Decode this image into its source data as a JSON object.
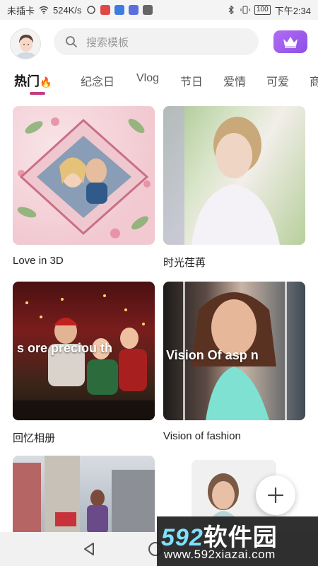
{
  "status_bar": {
    "carrier": "未插卡",
    "speed": "524K/s",
    "battery": "100",
    "time": "下午2:34"
  },
  "header": {
    "search_placeholder": "搜索模板"
  },
  "tabs": [
    {
      "label": "热门",
      "active": true
    },
    {
      "label": "纪念日"
    },
    {
      "label": "Vlog"
    },
    {
      "label": "节日"
    },
    {
      "label": "爱情"
    },
    {
      "label": "可爱"
    },
    {
      "label": "商"
    }
  ],
  "templates": [
    {
      "title": "Love in 3D"
    },
    {
      "title": "时光荏苒"
    },
    {
      "title": "回忆相册",
      "overlay": "s  ore preciou  th"
    },
    {
      "title": "Vision of  fashion",
      "overlay": "Vision Of  asp n"
    },
    {
      "title": ""
    },
    {
      "title": ""
    }
  ],
  "watermark": {
    "logo_num": "592",
    "logo_text": "软件园",
    "url": "www.592xiazai.com"
  },
  "colors": {
    "accent": "#c63d7f",
    "vip": "#9b59ea"
  }
}
